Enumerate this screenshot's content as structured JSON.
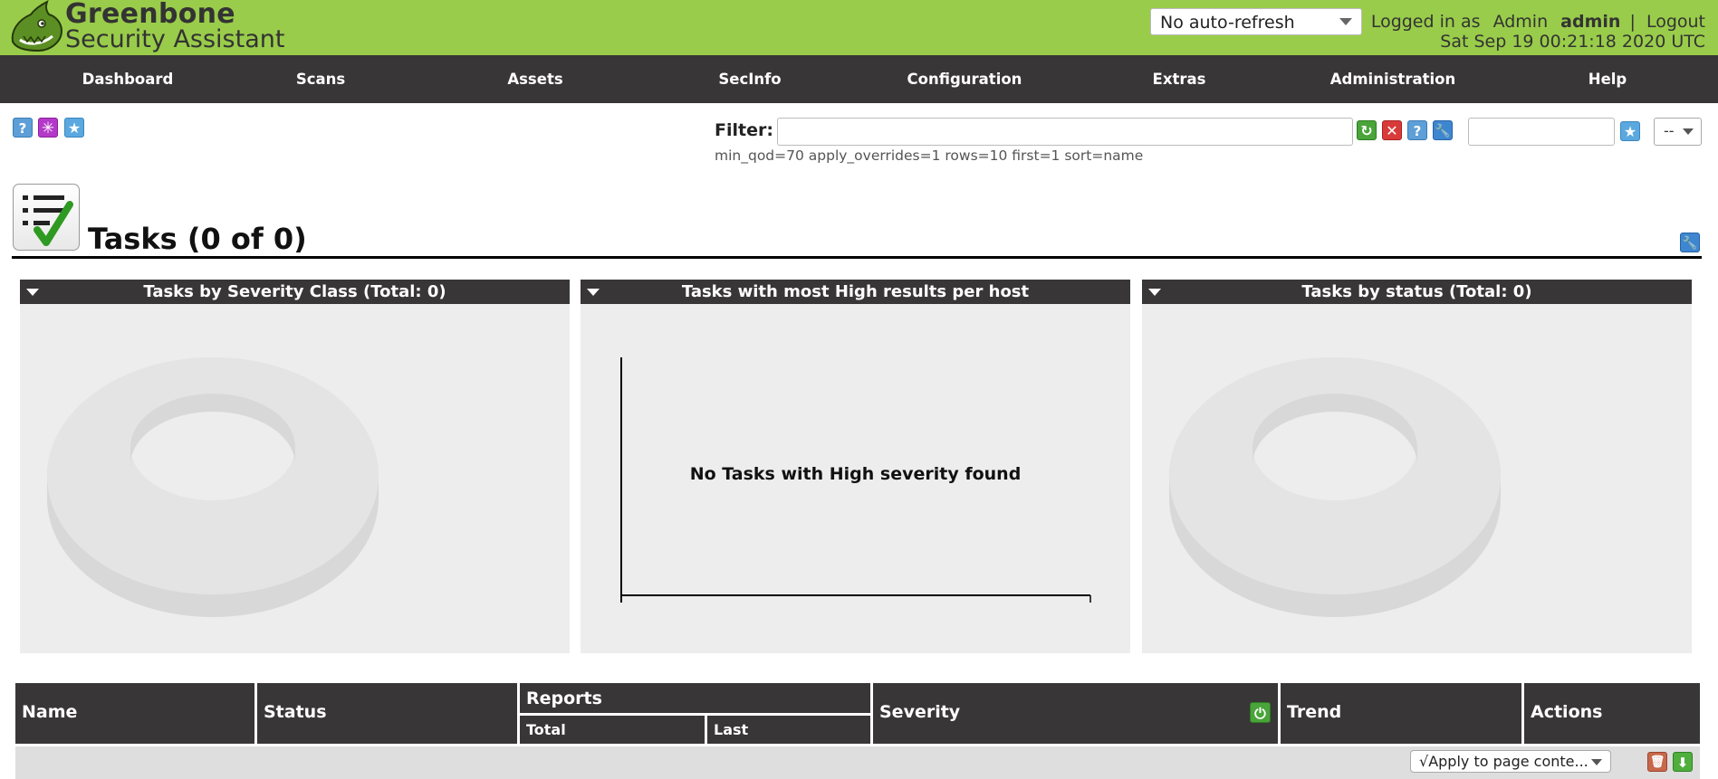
{
  "header": {
    "brand_line1": "Greenbone",
    "brand_line2": "Security Assistant",
    "refresh_select": "No auto-refresh",
    "logged_in_label": "Logged in as",
    "role": "Admin",
    "username": "admin",
    "separator": "|",
    "logout": "Logout",
    "datetime": "Sat Sep 19 00:21:18 2020 UTC"
  },
  "nav": {
    "items": [
      "Dashboard",
      "Scans",
      "Assets",
      "SecInfo",
      "Configuration",
      "Extras",
      "Administration",
      "Help"
    ]
  },
  "toolbar": {
    "help_icon": "help-icon",
    "new_icon": "new-task-wizard-icon",
    "star_icon": "new-task-icon"
  },
  "filter": {
    "label": "Filter:",
    "value": "",
    "summary": "min_qod=70 apply_overrides=1 rows=10 first=1 sort=name",
    "name_value": "",
    "select_value": "--"
  },
  "section": {
    "title": "Tasks (0 of 0)"
  },
  "panels": [
    {
      "title": "Tasks by Severity Class (Total: 0)"
    },
    {
      "title": "Tasks with most High results per host",
      "empty_message": "No Tasks with High severity found"
    },
    {
      "title": "Tasks by status (Total: 0)"
    }
  ],
  "table": {
    "headers": {
      "name": "Name",
      "status": "Status",
      "reports": "Reports",
      "total": "Total",
      "last": "Last",
      "severity": "Severity",
      "trend": "Trend",
      "actions": "Actions"
    },
    "footer_select": "√Apply to page conte..."
  },
  "colors": {
    "header_green": "#99cc4a",
    "nav_dark": "#393637"
  }
}
